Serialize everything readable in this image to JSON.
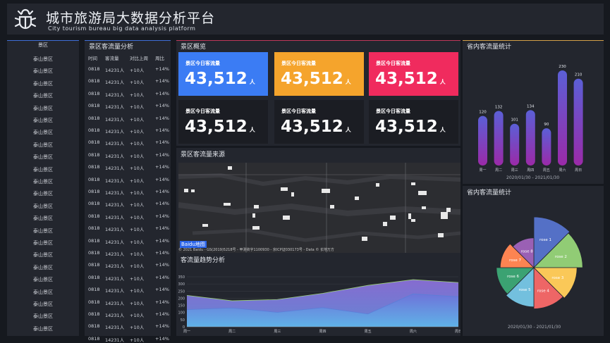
{
  "header": {
    "title_cn": "城市旅游局大数据分析平台",
    "title_en": "City tourism bureau big data analysis platform"
  },
  "scenic_list": {
    "header": "景区",
    "items": [
      "泰山景区",
      "泰山景区",
      "泰山景区",
      "泰山景区",
      "泰山景区",
      "泰山景区",
      "泰山景区",
      "泰山景区",
      "泰山景区",
      "泰山景区",
      "泰山景区",
      "泰山景区",
      "泰山景区",
      "泰山景区",
      "泰山景区",
      "泰山景区",
      "泰山景区",
      "泰山景区",
      "泰山景区",
      "泰山景区",
      "泰山景区",
      "泰山景区",
      "泰山景区"
    ]
  },
  "flow_table": {
    "title": "景区客流量分析",
    "columns": [
      "时间",
      "客流量",
      "对比上周",
      "周比"
    ],
    "rows": [
      [
        "0818",
        "14231人",
        "+10人",
        "+14%"
      ],
      [
        "0818",
        "14231人",
        "+10人",
        "+14%"
      ],
      [
        "0818",
        "14231人",
        "+10人",
        "+14%"
      ],
      [
        "0818",
        "14231人",
        "+10人",
        "+14%"
      ],
      [
        "0818",
        "14231人",
        "+10人",
        "+14%"
      ],
      [
        "0818",
        "14231人",
        "+10人",
        "+14%"
      ],
      [
        "0818",
        "14231人",
        "+10人",
        "+14%"
      ],
      [
        "0818",
        "14231人",
        "+10人",
        "+14%"
      ],
      [
        "0818",
        "14231人",
        "+10人",
        "+14%"
      ],
      [
        "0818",
        "14231人",
        "+10人",
        "+14%"
      ],
      [
        "0818",
        "14231人",
        "+10人",
        "+14%"
      ],
      [
        "0818",
        "14231人",
        "+10人",
        "+14%"
      ],
      [
        "0818",
        "14231人",
        "+10人",
        "+14%"
      ],
      [
        "0818",
        "14231人",
        "+10人",
        "+14%"
      ],
      [
        "0818",
        "14231人",
        "+10人",
        "+14%"
      ],
      [
        "0818",
        "14231人",
        "+10人",
        "+14%"
      ],
      [
        "0818",
        "14231人",
        "+10人",
        "+14%"
      ],
      [
        "0818",
        "14231人",
        "+10人",
        "+14%"
      ],
      [
        "0818",
        "14231人",
        "+10人",
        "+14%"
      ],
      [
        "0818",
        "14231人",
        "+10人",
        "+14%"
      ],
      [
        "0818",
        "14231人",
        "+10人",
        "+14%"
      ],
      [
        "0818",
        "14231人",
        "+10人",
        "+14%"
      ],
      [
        "0818",
        "14231人",
        "+10人",
        "+14%"
      ]
    ]
  },
  "overview": {
    "title": "景区概览",
    "cards": [
      {
        "label": "景区今日客流量",
        "value": "43,512",
        "unit": "人",
        "color": "#3b7cf4"
      },
      {
        "label": "景区今日客流量",
        "value": "43,512",
        "unit": "人",
        "color": "#f5a42c"
      },
      {
        "label": "景区今日客流量",
        "value": "43,512",
        "unit": "人",
        "color": "#f02b5e"
      },
      {
        "label": "景区今日客流量",
        "value": "43,512",
        "unit": "人",
        "color": "#1b1d23"
      },
      {
        "label": "景区今日客流量",
        "value": "43,512",
        "unit": "人",
        "color": "#1b1d23"
      },
      {
        "label": "景区今日客流量",
        "value": "43,512",
        "unit": "人",
        "color": "#1b1d23"
      }
    ]
  },
  "map_panel": {
    "title": "景区客流量来源",
    "logo_text": "Baidu地图",
    "credit": "© 2021 Baidu - GS(2019)5218号 - 甲测资字1100930 - 京ICP证030173号 - Data © 长地万方"
  },
  "trend": {
    "title": "客流量趋势分析"
  },
  "province_bar": {
    "title": "省内客流量统计",
    "date": "2020/01/30 - 2021/01/30"
  },
  "province_rose": {
    "title": "省内客流量统计",
    "date": "2020/01/30 - 2021/01/30"
  },
  "chart_data": [
    {
      "type": "bar",
      "categories": [
        "周一",
        "周二",
        "周三",
        "周四",
        "周五",
        "周六",
        "周日"
      ],
      "values": [
        120,
        132,
        101,
        134,
        90,
        230,
        210
      ],
      "colors": [
        "#5b5fd6",
        "#9b2aa8"
      ]
    },
    {
      "type": "area",
      "categories": [
        "周一",
        "周二",
        "周三",
        "周四",
        "周五",
        "周六",
        "周日"
      ],
      "ylim": [
        0,
        350
      ],
      "yticks": [
        0,
        50,
        100,
        150,
        200,
        250,
        300,
        350
      ],
      "series": [
        {
          "values": [
            220,
            182,
            191,
            234,
            290,
            330,
            310
          ],
          "color": "#8a6fd6"
        },
        {
          "values": [
            120,
            132,
            101,
            134,
            90,
            230,
            210
          ],
          "color": "#4b9fe0"
        }
      ]
    },
    {
      "type": "pie",
      "rose": true,
      "categories": [
        "rose 1",
        "rose 2",
        "rose 3",
        "rose 4",
        "rose 5",
        "rose 6",
        "rose 7",
        "rose 8"
      ],
      "values": [
        40,
        38,
        32,
        30,
        28,
        26,
        22,
        18
      ],
      "colors": [
        "#5470c6",
        "#91cc75",
        "#fac858",
        "#ee6666",
        "#73c0de",
        "#3ba272",
        "#fc8452",
        "#9a60b4"
      ]
    }
  ]
}
